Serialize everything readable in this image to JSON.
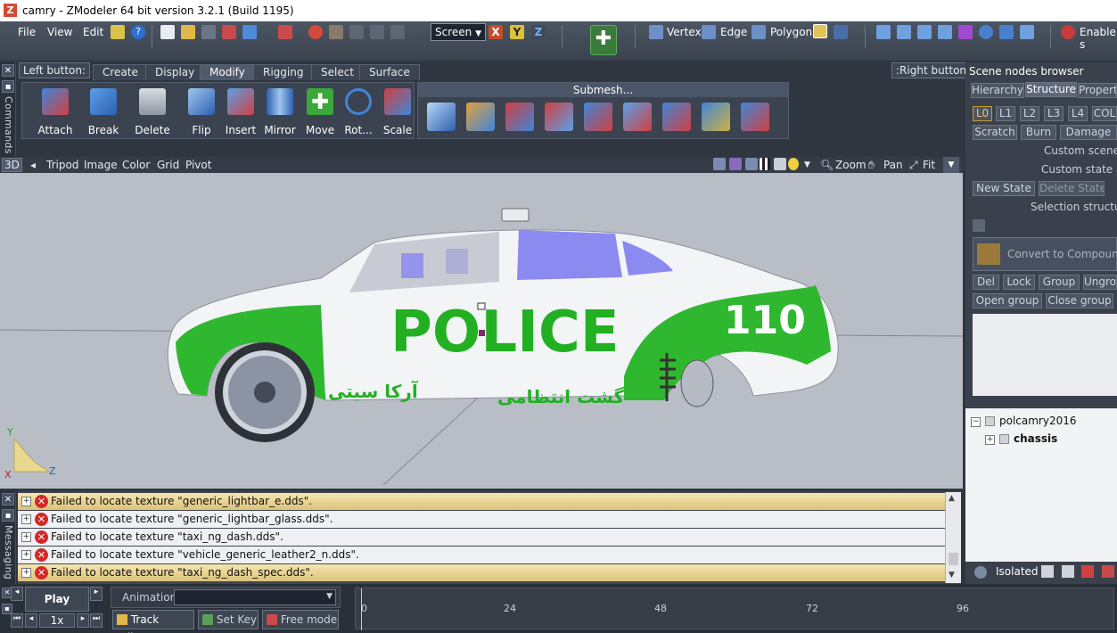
{
  "window": {
    "title": "camry - ZModeler 64 bit version 3.2.1 (Build 1195)",
    "icon": "z-app-icon"
  },
  "menu": [
    "File",
    "View",
    "Edit"
  ],
  "toolbar": {
    "screen_select": "Screen",
    "axis_buttons": [
      "X",
      "Y",
      "Z"
    ],
    "selection_modes": [
      "Vertex",
      "Edge",
      "Polygon"
    ],
    "enable_label": "Enable s"
  },
  "left_button_label": "Left button:",
  "right_button_label": ":Right button",
  "side_labels": {
    "commands": "Commands",
    "messaging": "Messaging"
  },
  "mode_tabs": [
    "Create",
    "Display",
    "Modify",
    "Rigging",
    "Select",
    "Surface"
  ],
  "active_tab": "Modify",
  "tools": [
    "Attach",
    "Break",
    "Delete",
    "Flip",
    "Insert",
    "Mirror",
    "Move",
    "Rot...",
    "Scale"
  ],
  "submesh_title": "Submesh...",
  "viewport_bar": {
    "mode": "3D",
    "items": [
      "Tripod",
      "Image",
      "Color",
      "Grid",
      "Pivot"
    ],
    "nav": [
      "Zoom",
      "Pan",
      "Fit"
    ]
  },
  "car": {
    "police_text": "POLICE",
    "number": "110",
    "persian_left": "آرکا سیتی",
    "persian_right": "گشت انتظامی"
  },
  "axes": {
    "x": "X",
    "y": "Y",
    "z": "Z"
  },
  "messages": [
    {
      "text": "Failed to locate texture \"generic_lightbar_e.dds\".",
      "highlight": true
    },
    {
      "text": "Failed to locate texture \"generic_lightbar_glass.dds\".",
      "highlight": false
    },
    {
      "text": "Failed to locate texture \"taxi_ng_dash.dds\".",
      "highlight": false
    },
    {
      "text": "Failed to locate texture \"vehicle_generic_leather2_n.dds\".",
      "highlight": false
    },
    {
      "text": "Failed to locate texture \"taxi_ng_dash_spec.dds\".",
      "highlight": true
    }
  ],
  "scene_browser": {
    "title": "Scene nodes browser",
    "tabs": [
      "Hierarchy",
      "Structure",
      "Propert"
    ],
    "lod": [
      "L0",
      "L1",
      "L2",
      "L3",
      "L4",
      "COL"
    ],
    "states": [
      "Scratch",
      "Burn",
      "Damage"
    ],
    "custom_scene": "Custom scene st",
    "custom_state": "Custom state act",
    "new_state": "New State",
    "delete_state": "Delete State",
    "selection_structure": "Selection structure",
    "convert": "Convert to Compound",
    "buttons_row1": [
      "Del",
      "Lock",
      "Group",
      "Ungro"
    ],
    "buttons_row2": [
      "Open group",
      "Close group"
    ],
    "tree": [
      "polcamry2016",
      "chassis"
    ],
    "isolated": "Isolated"
  },
  "timeline": {
    "play": "Play",
    "speed": "1x",
    "animation_label": "Animation:",
    "track_editor": "Track Editor",
    "set_key": "Set Key",
    "free_mode": "Free mode",
    "ticks": [
      "0",
      "24",
      "48",
      "72",
      "96"
    ]
  }
}
